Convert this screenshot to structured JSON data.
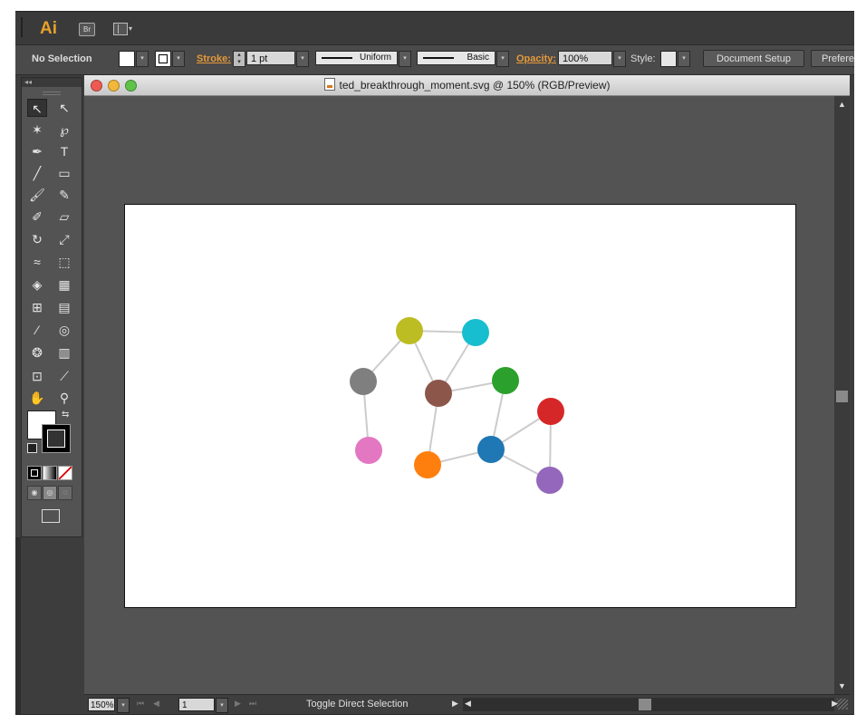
{
  "app": {
    "logo": "Ai",
    "bridge_label": "Br"
  },
  "control_bar": {
    "selection_status": "No Selection",
    "stroke_label": "Stroke:",
    "stroke_weight": "1 pt",
    "variable_width_profile": "Uniform",
    "brush_definition": "Basic",
    "opacity_label": "Opacity:",
    "opacity_value": "100%",
    "style_label": "Style:",
    "document_setup_button": "Document Setup",
    "preferences_button": "Prefere"
  },
  "document": {
    "title": "ted_breakthrough_moment.svg @ 150% (RGB/Preview)",
    "zoom": "150%",
    "artboard_number": "1",
    "status_text": "Toggle Direct Selection"
  },
  "tools": [
    {
      "name": "selection-tool",
      "glyph": "↖"
    },
    {
      "name": "direct-selection-tool",
      "glyph": "↖"
    },
    {
      "name": "magic-wand-tool",
      "glyph": "✶"
    },
    {
      "name": "lasso-tool",
      "glyph": "℘"
    },
    {
      "name": "pen-tool",
      "glyph": "✒"
    },
    {
      "name": "type-tool",
      "glyph": "T"
    },
    {
      "name": "line-segment-tool",
      "glyph": "╱"
    },
    {
      "name": "rectangle-tool",
      "glyph": "▭"
    },
    {
      "name": "paintbrush-tool",
      "glyph": "🖌"
    },
    {
      "name": "pencil-tool",
      "glyph": "✎"
    },
    {
      "name": "blob-brush-tool",
      "glyph": "✐"
    },
    {
      "name": "eraser-tool",
      "glyph": "▱"
    },
    {
      "name": "rotate-tool",
      "glyph": "↻"
    },
    {
      "name": "scale-tool",
      "glyph": "⤢"
    },
    {
      "name": "width-tool",
      "glyph": "≈"
    },
    {
      "name": "free-transform-tool",
      "glyph": "⬚"
    },
    {
      "name": "shape-builder-tool",
      "glyph": "◈"
    },
    {
      "name": "perspective-grid-tool",
      "glyph": "▦"
    },
    {
      "name": "mesh-tool",
      "glyph": "⊞"
    },
    {
      "name": "gradient-tool",
      "glyph": "▤"
    },
    {
      "name": "eyedropper-tool",
      "glyph": "⁄"
    },
    {
      "name": "blend-tool",
      "glyph": "◎"
    },
    {
      "name": "symbol-sprayer-tool",
      "glyph": "❂"
    },
    {
      "name": "column-graph-tool",
      "glyph": "▥"
    },
    {
      "name": "artboard-tool",
      "glyph": "⊡"
    },
    {
      "name": "slice-tool",
      "glyph": "⟋"
    },
    {
      "name": "hand-tool",
      "glyph": "✋"
    },
    {
      "name": "zoom-tool",
      "glyph": "⚲"
    }
  ],
  "graph": {
    "nodes": [
      {
        "id": "olive",
        "color": "#bcbd22"
      },
      {
        "id": "cyan",
        "color": "#17becf"
      },
      {
        "id": "gray",
        "color": "#7f7f7f"
      },
      {
        "id": "brown",
        "color": "#8c564b"
      },
      {
        "id": "green",
        "color": "#2ca02c"
      },
      {
        "id": "red",
        "color": "#d62728"
      },
      {
        "id": "pink",
        "color": "#e377c2"
      },
      {
        "id": "orange",
        "color": "#ff7f0e"
      },
      {
        "id": "blue",
        "color": "#1f77b4"
      },
      {
        "id": "purple",
        "color": "#9467bd"
      }
    ],
    "edges": [
      [
        "olive",
        "cyan"
      ],
      [
        "olive",
        "gray"
      ],
      [
        "olive",
        "brown"
      ],
      [
        "cyan",
        "brown"
      ],
      [
        "brown",
        "green"
      ],
      [
        "brown",
        "orange"
      ],
      [
        "gray",
        "pink"
      ],
      [
        "green",
        "blue"
      ],
      [
        "orange",
        "blue"
      ],
      [
        "blue",
        "red"
      ],
      [
        "blue",
        "purple"
      ],
      [
        "red",
        "purple"
      ]
    ],
    "edge_color": "#cccccc"
  }
}
